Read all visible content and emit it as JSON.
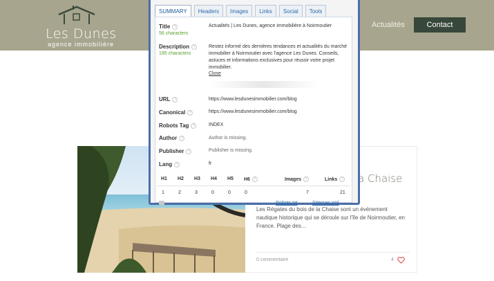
{
  "site": {
    "logo_name": "Les Dunes",
    "logo_tagline": "agence immobilière",
    "nav_actualites": "Actualités",
    "contact_label": "Contact",
    "colors": {
      "header_bg": "#a7a58d",
      "contact_bg": "#37473a"
    }
  },
  "article": {
    "title_fragment": "a Chaise",
    "excerpt": "Les Régates du bois de la Chaise sont un événement nautique historique qui se déroule sur l'île de Noirmoutier, en France. Plage des...",
    "comments": "0 commentaire",
    "likes": "4"
  },
  "seo_popup": {
    "tabs": [
      {
        "label": "SUMMARY",
        "active": true
      },
      {
        "label": "Headers",
        "active": false
      },
      {
        "label": "Images",
        "active": false
      },
      {
        "label": "Links",
        "active": false
      },
      {
        "label": "Social",
        "active": false
      },
      {
        "label": "Tools",
        "active": false
      }
    ],
    "title": {
      "label": "Title",
      "count": "56 characters",
      "value": "Actualités | Les Dunes, agence immobilière à Noirmoutier"
    },
    "description": {
      "label": "Description",
      "count": "195 characters",
      "value": "Restez informé des dernières tendances et actualités du marché immobilier à Noirmoutier avec l'agence Les Dunes. Conseils, astuces et informations exclusives pour réussir votre projet immobilier.",
      "close": "Close"
    },
    "url": {
      "label": "URL",
      "value": "https://www.lesdunesimmobilier.com/blog"
    },
    "canonical": {
      "label": "Canonical",
      "value": "https://www.lesdunesimmobilier.com/blog"
    },
    "robots": {
      "label": "Robots Tag",
      "value": "INDEX"
    },
    "author": {
      "label": "Author",
      "value": "Author is missing."
    },
    "publisher": {
      "label": "Publisher",
      "value": "Publisher is missing."
    },
    "lang": {
      "label": "Lang",
      "value": "fr"
    },
    "headings": {
      "headers": [
        "H1",
        "H2",
        "H3",
        "H4",
        "H5",
        "H6"
      ],
      "values": [
        "1",
        "2",
        "3",
        "0",
        "0",
        "0"
      ],
      "images_label": "Images",
      "images_value": "7",
      "links_label": "Links",
      "links_value": "21"
    },
    "footer": {
      "robots_link": "Robots.txt",
      "sitemap_link": "Sitemap.xml"
    },
    "colors": {
      "frame": "#4a6ea8",
      "tab_text": "#2f6bab",
      "count_green": "#5aa02c"
    }
  }
}
